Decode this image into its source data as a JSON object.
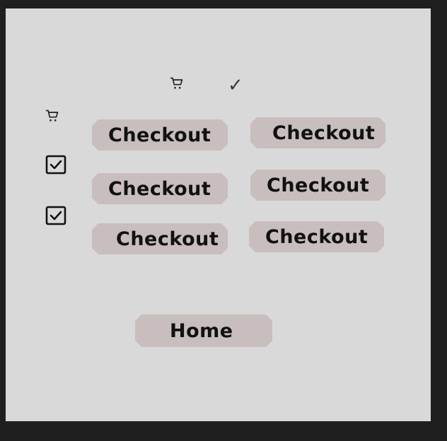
{
  "icons": {
    "cart_top": "cart-icon",
    "cart_left": "cart-icon",
    "check_top": "check-icon",
    "checkbox_1": "checked-box-icon",
    "checkbox_2": "checked-box-icon"
  },
  "check_glyph": "✓",
  "buttons": {
    "checkout_1": "Checkout",
    "checkout_2": "Checkout",
    "checkout_3": "Checkout",
    "checkout_4": "Checkout",
    "checkout_5": "Checkout",
    "checkout_6": "Checkout",
    "home": "Home"
  },
  "colors": {
    "background": "#1f1f1f",
    "panel": "#d9d9d9",
    "button": "#c9bebe",
    "text": "#111111"
  }
}
